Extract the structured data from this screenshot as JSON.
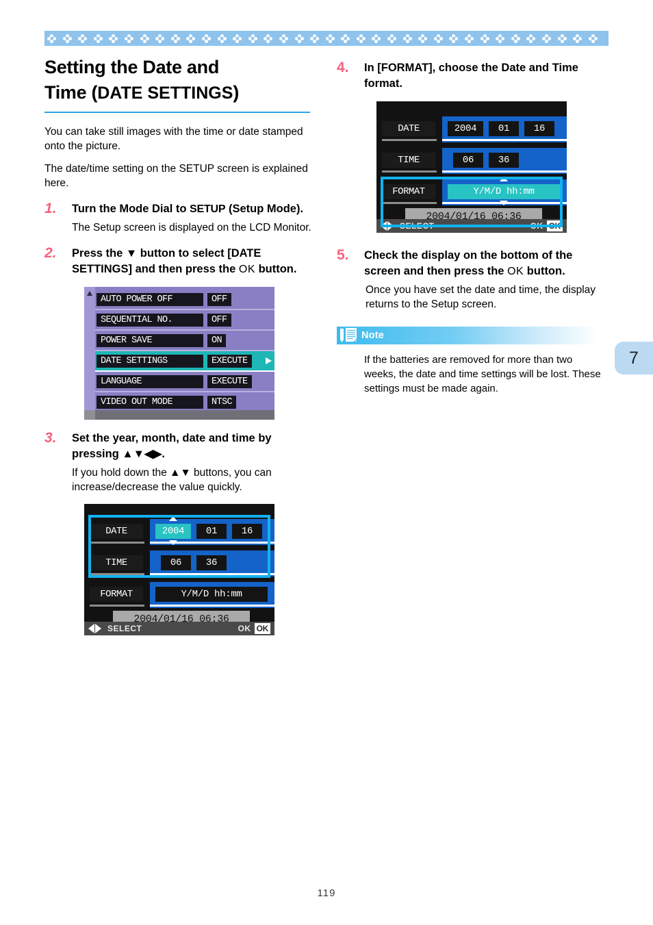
{
  "page": {
    "folio": "119",
    "tab_number": "7"
  },
  "header": {
    "title_line1": "Setting the Date and",
    "title_line2_prefix": "Time (",
    "title_line2_caps": "DATE SETTINGS",
    "title_line2_suffix": ")"
  },
  "intro": {
    "p1": "You can take still images with the time or date stamped onto the picture.",
    "p2": "The date/time setting on the SETUP screen is explained here."
  },
  "steps": [
    {
      "num": "1.",
      "text_a": "Turn the Mode Dial to ",
      "text_b": "SETUP",
      "text_c": " (Setup Mode).",
      "sub": "The Setup screen is displayed on the LCD Monitor."
    },
    {
      "num": "2.",
      "text_a": "Press the ▼ button to select [DATE SETTINGS] and then press the ",
      "text_b": "OK",
      "text_c": " button."
    },
    {
      "num": "3.",
      "text_a": "Set the year, month, date and time by pressing ▲▼◀▶.",
      "sub": "If you hold down the ▲▼ buttons, you can increase/decrease the value quickly."
    },
    {
      "num": "4.",
      "text_a": "In [FORMAT], choose the Date and Time format."
    },
    {
      "num": "5.",
      "text_a": "Check the display on the bottom of the screen and then press the ",
      "text_b": "OK",
      "text_c": " button.",
      "sub": "Once you have set the date and time, the display returns to the Setup screen."
    }
  ],
  "lcd_setup": {
    "rows": [
      {
        "label": "AUTO POWER OFF",
        "value": "OFF",
        "active": false
      },
      {
        "label": "SEQUENTIAL NO.",
        "value": "OFF",
        "active": false
      },
      {
        "label": "POWER SAVE",
        "value": "ON",
        "active": false
      },
      {
        "label": "DATE SETTINGS",
        "value": "EXECUTE",
        "active": true
      },
      {
        "label": "LANGUAGE",
        "value": "EXECUTE",
        "active": false
      },
      {
        "label": "VIDEO OUT MODE",
        "value": "NTSC",
        "active": false
      }
    ],
    "colors": {
      "background": "#8a7fc4",
      "highlight": "#1fb6b6"
    }
  },
  "lcd_date": {
    "date_label": "DATE",
    "date_year": "2004",
    "date_month": "01",
    "date_day": "16",
    "time_label": "TIME",
    "time_hour": "06",
    "time_minute": "36",
    "format_label": "FORMAT",
    "format_value": "Y/M/D hh:mm",
    "summary": "2004/01/16 06:36",
    "bar_select": "SELECT",
    "bar_ok": "OK",
    "bar_ok_badge": "OK",
    "highlight_color": "#12b2ef",
    "selected_field_step3": "2004",
    "selected_field_step4": "Y/M/D hh:mm"
  },
  "note": {
    "label": "Note",
    "body": "If the batteries are removed for more than two weeks, the date and time settings will be lost. These settings must be made again."
  }
}
